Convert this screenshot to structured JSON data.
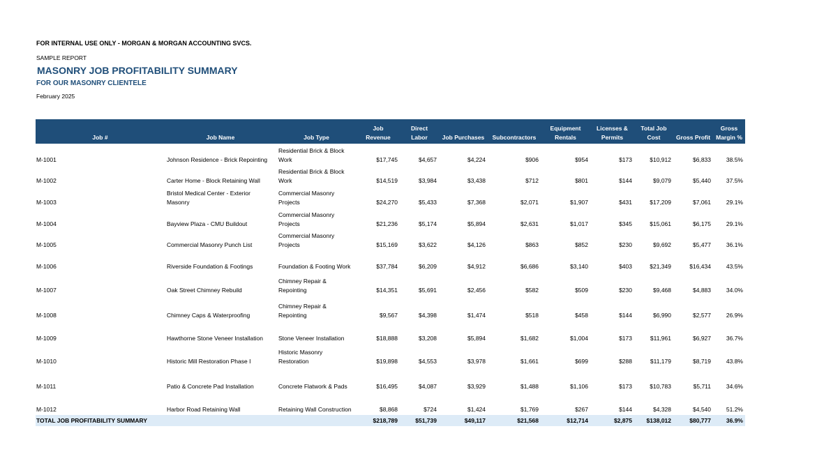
{
  "header": {
    "internal_line": "FOR INTERNAL USE ONLY - MORGAN & MORGAN ACCOUNTING SVCS.",
    "sample_line": "SAMPLE REPORT",
    "title": "MASONRY JOB PROFITABILITY SUMMARY",
    "subtitle": "FOR OUR MASONRY CLIENTELE",
    "date": "February 2025"
  },
  "table": {
    "columns": [
      "Job #",
      "Job Name",
      "Job Type",
      "Job\nRevenue",
      "Direct\nLabor",
      "Job Purchases",
      "Subcontractors",
      "Equipment\nRentals",
      "Licenses &\nPermits",
      "Total Job\nCost",
      "Gross Profit",
      "Gross\nMargin %"
    ],
    "rows": [
      {
        "job": "M-1001",
        "name": "Johnson Residence - Brick Repointing",
        "type": "Residential Brick & Block Work",
        "revenue": "$17,745",
        "labor": "$4,657",
        "purchases": "$4,224",
        "subs": "$906",
        "equipment": "$954",
        "permits": "$173",
        "cost": "$10,912",
        "profit": "$6,833",
        "margin": "38.5%"
      },
      {
        "job": "M-1002",
        "name": "Carter Home - Block Retaining Wall",
        "type": "Residential Brick & Block Work",
        "revenue": "$14,519",
        "labor": "$3,984",
        "purchases": "$3,438",
        "subs": "$712",
        "equipment": "$801",
        "permits": "$144",
        "cost": "$9,079",
        "profit": "$5,440",
        "margin": "37.5%"
      },
      {
        "job": "M-1003",
        "name": "Bristol Medical Center - Exterior Masonry",
        "type": "Commercial Masonry Projects",
        "revenue": "$24,270",
        "labor": "$5,433",
        "purchases": "$7,368",
        "subs": "$2,071",
        "equipment": "$1,907",
        "permits": "$431",
        "cost": "$17,209",
        "profit": "$7,061",
        "margin": "29.1%"
      },
      {
        "job": "M-1004",
        "name": "Bayview Plaza - CMU Buildout",
        "type": "Commercial Masonry Projects",
        "revenue": "$21,236",
        "labor": "$5,174",
        "purchases": "$5,894",
        "subs": "$2,631",
        "equipment": "$1,017",
        "permits": "$345",
        "cost": "$15,061",
        "profit": "$6,175",
        "margin": "29.1%"
      },
      {
        "job": "M-1005",
        "name": "Commercial Masonry Punch List",
        "type": "Commercial Masonry Projects",
        "revenue": "$15,169",
        "labor": "$3,622",
        "purchases": "$4,126",
        "subs": "$863",
        "equipment": "$852",
        "permits": "$230",
        "cost": "$9,692",
        "profit": "$5,477",
        "margin": "36.1%"
      },
      {
        "job": "M-1006",
        "name": "Riverside Foundation & Footings",
        "type": "Foundation & Footing Work",
        "revenue": "$37,784",
        "labor": "$6,209",
        "purchases": "$4,912",
        "subs": "$6,686",
        "equipment": "$3,140",
        "permits": "$403",
        "cost": "$21,349",
        "profit": "$16,434",
        "margin": "43.5%"
      },
      {
        "job": "M-1007",
        "name": "Oak Street Chimney Rebuild",
        "type": "Chimney Repair & Repointing",
        "revenue": "$14,351",
        "labor": "$5,691",
        "purchases": "$2,456",
        "subs": "$582",
        "equipment": "$509",
        "permits": "$230",
        "cost": "$9,468",
        "profit": "$4,883",
        "margin": "34.0%"
      },
      {
        "job": "M-1008",
        "name": "Chimney Caps & Waterproofing",
        "type": "Chimney Repair & Repointing",
        "revenue": "$9,567",
        "labor": "$4,398",
        "purchases": "$1,474",
        "subs": "$518",
        "equipment": "$458",
        "permits": "$144",
        "cost": "$6,990",
        "profit": "$2,577",
        "margin": "26.9%"
      },
      {
        "job": "M-1009",
        "name": "Hawthorne Stone Veneer Installation",
        "type": "Stone Veneer Installation",
        "revenue": "$18,888",
        "labor": "$3,208",
        "purchases": "$5,894",
        "subs": "$1,682",
        "equipment": "$1,004",
        "permits": "$173",
        "cost": "$11,961",
        "profit": "$6,927",
        "margin": "36.7%"
      },
      {
        "job": "M-1010",
        "name": "Historic Mill Restoration Phase I",
        "type": "Historic Masonry Restoration",
        "revenue": "$19,898",
        "labor": "$4,553",
        "purchases": "$3,978",
        "subs": "$1,661",
        "equipment": "$699",
        "permits": "$288",
        "cost": "$11,179",
        "profit": "$8,719",
        "margin": "43.8%"
      },
      {
        "job": "M-1011",
        "name": "Patio & Concrete Pad Installation",
        "type": "Concrete Flatwork & Pads",
        "revenue": "$16,495",
        "labor": "$4,087",
        "purchases": "$3,929",
        "subs": "$1,488",
        "equipment": "$1,106",
        "permits": "$173",
        "cost": "$10,783",
        "profit": "$5,711",
        "margin": "34.6%"
      },
      {
        "job": "M-1012",
        "name": "Harbor Road Retaining Wall",
        "type": "Retaining Wall Construction",
        "revenue": "$8,868",
        "labor": "$724",
        "purchases": "$1,424",
        "subs": "$1,769",
        "equipment": "$267",
        "permits": "$144",
        "cost": "$4,328",
        "profit": "$4,540",
        "margin": "51.2%"
      }
    ],
    "total": {
      "label": "TOTAL JOB PROFITABILITY SUMMARY",
      "revenue": "$218,789",
      "labor": "$51,739",
      "purchases": "$49,117",
      "subs": "$21,568",
      "equipment": "$12,714",
      "permits": "$2,875",
      "cost": "$138,012",
      "profit": "$80,777",
      "margin": "36.9%"
    }
  }
}
